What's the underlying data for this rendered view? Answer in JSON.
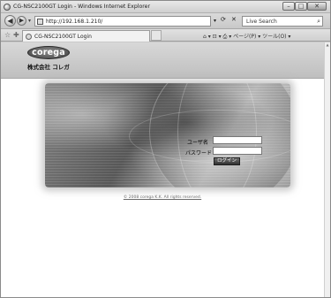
{
  "window": {
    "title": "CG-NSC2100GT Login - Windows Internet Explorer"
  },
  "controls": {
    "minimize": "–",
    "maximize": "□",
    "close": "✕"
  },
  "nav": {
    "back": "◀",
    "forward": "▶",
    "dropdown": "▾",
    "address": "http://192.168.1.210/",
    "address_dropdown": "▾",
    "refresh": "⟳",
    "stop": "✕",
    "search_placeholder": "Live Search",
    "search_icon": "⌕"
  },
  "tabs": {
    "favorites_icon": "☆",
    "add_favorites_icon": "✚",
    "active_tab": "CG-NSC2100GT Login",
    "command_bar": "⌂ ▾  ⊡ ▾  ⎙ ▾  ページ(P) ▾  ツール(O) ▾"
  },
  "page": {
    "logo": "corega",
    "company": "株式会社 コレガ",
    "username_label": "ユーザ名",
    "password_label": "パスワード",
    "login_button": "ログイン",
    "copyright": "© 2008 corega K.K. All rights reserved."
  },
  "icons": {
    "ie_icon": "ie-icon",
    "page_icon": "page-icon",
    "scroll_up": "▲"
  }
}
